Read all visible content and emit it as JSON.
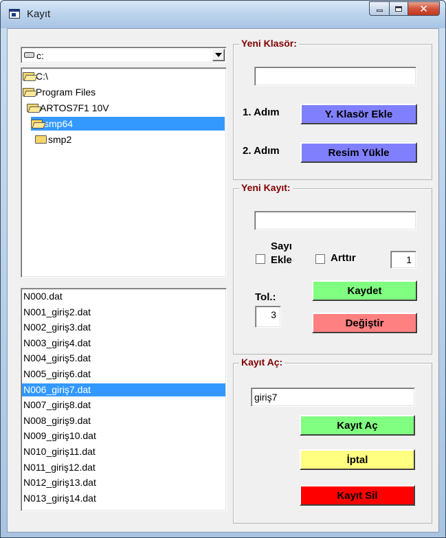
{
  "window": {
    "title": "Kayıt"
  },
  "drive": {
    "value": "c:"
  },
  "directories": [
    {
      "label": "C:\\",
      "indent": 0,
      "open": true,
      "selected": false
    },
    {
      "label": "Program Files",
      "indent": 0,
      "open": true,
      "selected": false
    },
    {
      "label": "ARTOS7F1 10V",
      "indent": 1,
      "open": true,
      "selected": false
    },
    {
      "label": "smp64",
      "indent": 2,
      "open": true,
      "selected": true
    },
    {
      "label": "smp2",
      "indent": 3,
      "open": false,
      "selected": false
    }
  ],
  "files": [
    {
      "label": "N000.dat",
      "selected": false
    },
    {
      "label": "N001_giriş2.dat",
      "selected": false
    },
    {
      "label": "N002_giriş3.dat",
      "selected": false
    },
    {
      "label": "N003_giriş4.dat",
      "selected": false
    },
    {
      "label": "N004_giriş5.dat",
      "selected": false
    },
    {
      "label": "N005_giriş6.dat",
      "selected": false
    },
    {
      "label": "N006_giriş7.dat",
      "selected": true
    },
    {
      "label": "N007_giriş8.dat",
      "selected": false
    },
    {
      "label": "N008_giriş9.dat",
      "selected": false
    },
    {
      "label": "N009_giriş10.dat",
      "selected": false
    },
    {
      "label": "N010_giriş11.dat",
      "selected": false
    },
    {
      "label": "N011_giriş12.dat",
      "selected": false
    },
    {
      "label": "N012_giriş13.dat",
      "selected": false
    },
    {
      "label": "N013_giriş14.dat",
      "selected": false
    }
  ],
  "new_folder": {
    "title": "Yeni Klasör:",
    "name_value": "",
    "step1_label": "1. Adım",
    "step1_button": "Y. Klasör Ekle",
    "step2_label": "2. Adım",
    "step2_button": "Resim Yükle"
  },
  "new_record": {
    "title": "Yeni Kayıt:",
    "name_value": "",
    "add_number_label_1": "Sayı",
    "add_number_label_2": "Ekle",
    "increment_label": "Arttır",
    "increment_value": "1",
    "tol_label": "Tol.:",
    "tol_value": "3",
    "save_button": "Kaydet",
    "change_button": "Değiştir"
  },
  "open_record": {
    "title": "Kayıt Aç:",
    "name_value": "giriş7",
    "open_button": "Kayıt Aç",
    "cancel_button": "İptal",
    "delete_button": "Kayıt Sil"
  },
  "colors": {
    "blue_button": "#8080ff",
    "green_button": "#80ff80",
    "red_soft_button": "#ff8080",
    "yellow_button": "#ffff80",
    "red_button": "#ff0000",
    "selection": "#3399ff",
    "group_title": "#800000"
  },
  "icons": {
    "app": "app-icon",
    "minimize": "minimize-icon",
    "maximize": "maximize-icon",
    "close": "close-icon",
    "drive": "drive-icon",
    "folder": "folder-icon",
    "combo_arrow": "chevron-down-icon"
  }
}
